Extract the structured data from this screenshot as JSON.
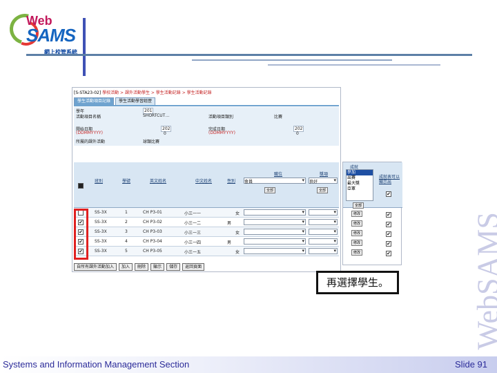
{
  "logo": {
    "web": "Web",
    "sams": "SAMS",
    "zh": "網上校管系統"
  },
  "brand_vertical": "WebSAMS",
  "footer": {
    "section": "Systems and Information Management Section",
    "slide": "Slide 91"
  },
  "callout": "再選擇學生。",
  "screen": {
    "breadcrumb_code": "[S-STA23-02]",
    "breadcrumb_path": "學校活動 > 課外活動學生 > 學生活動記錄 > 學生活動記錄",
    "tabs": [
      "學生活動項目記錄",
      "學生活動學習經歷"
    ],
    "form": {
      "year_label": "學年",
      "year_value": "201",
      "activity_name_label": "活動項目名稱",
      "activity_name_value": "SHORTCUT…",
      "date_label": "開始日期",
      "date_format": "(DDMMYYYY)",
      "date_value": "202",
      "date_value2": "0",
      "type_label": "活動項目類別",
      "type_value": "比賽",
      "end_label": "完成日期",
      "end_format": "(DDMMYYYY)",
      "end_value": "202",
      "end_value2": "0",
      "related_label": "所屬的課外活動",
      "related_value": "球類比賽"
    },
    "columns": {
      "select": "■",
      "class": "班別",
      "number": "學號",
      "eng_name": "英文姓名",
      "chi_name": "中文姓名",
      "gender": "性別",
      "post": "職位",
      "award": "獎項",
      "achievement": "成就",
      "show": "成就表可以顯示出"
    },
    "post_options": {
      "default": "會員",
      "button": "全部"
    },
    "award_options": {
      "default": "良好",
      "button": "全部"
    },
    "achievement_list": [
      "參加",
      "出賽",
      "最大獎",
      "亞軍"
    ],
    "achievement_button": "全部",
    "rows": [
      {
        "checked": false,
        "class": "SS-3X",
        "number": "1",
        "eng": "CH P3-01",
        "chi": "小三一一",
        "gender": "女",
        "btn": "修改",
        "show": true
      },
      {
        "checked": true,
        "class": "SS-3X",
        "number": "2",
        "eng": "CH P3-02",
        "chi": "小三一二",
        "gender": "男",
        "btn": "修改",
        "show": true
      },
      {
        "checked": true,
        "class": "SS-3X",
        "number": "3",
        "eng": "CH P3-03",
        "chi": "小三一三",
        "gender": "女",
        "btn": "修改",
        "show": true
      },
      {
        "checked": true,
        "class": "SS-3X",
        "number": "4",
        "eng": "CH P3-04",
        "chi": "小三一四",
        "gender": "男",
        "btn": "修改",
        "show": true
      },
      {
        "checked": true,
        "class": "SS-3X",
        "number": "5",
        "eng": "CH P3-05",
        "chi": "小三一五",
        "gender": "女",
        "btn": "修改",
        "show": true
      }
    ],
    "bottom_buttons": [
      "自所有課外活動加入",
      "加入",
      "刪除",
      "顯示",
      "儲存",
      "返回頁面"
    ]
  }
}
